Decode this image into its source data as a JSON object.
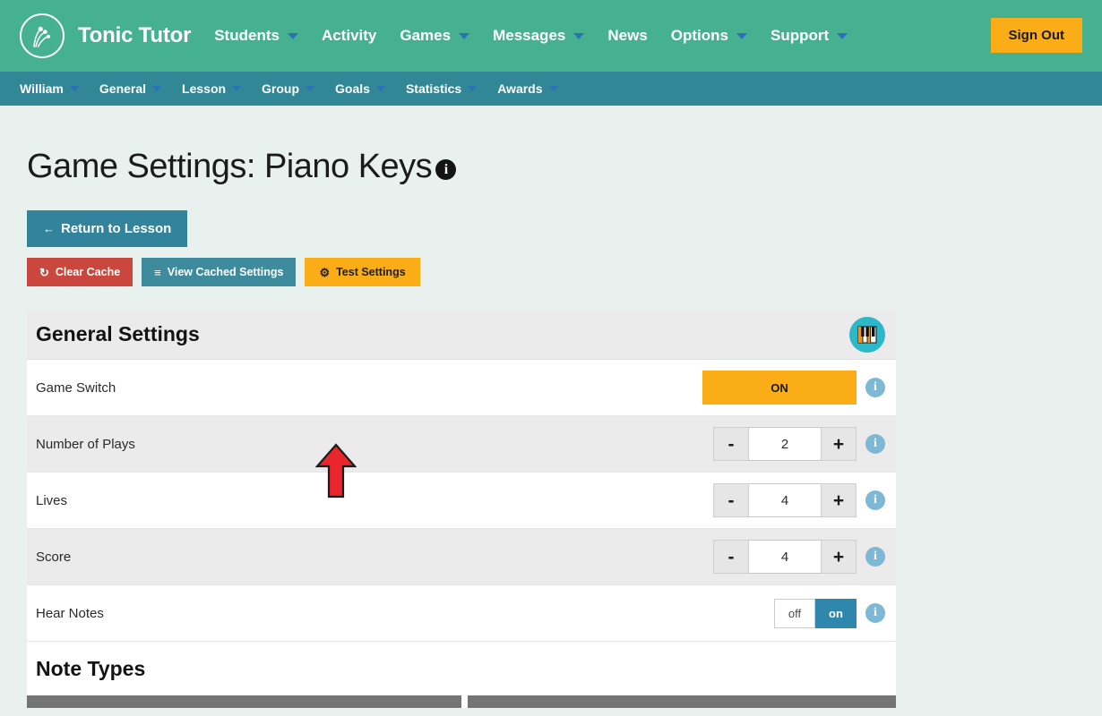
{
  "topnav": {
    "brand": "Tonic Tutor",
    "logo_icon": "tonic-sprout-logo",
    "items": [
      {
        "label": "Students",
        "has_caret": true
      },
      {
        "label": "Activity",
        "has_caret": false
      },
      {
        "label": "Games",
        "has_caret": true
      },
      {
        "label": "Messages",
        "has_caret": true
      },
      {
        "label": "News",
        "has_caret": false
      },
      {
        "label": "Options",
        "has_caret": true
      },
      {
        "label": "Support",
        "has_caret": true
      }
    ],
    "signout_label": "Sign Out",
    "bg_color": "#45b191",
    "signout_color": "#fbad17"
  },
  "subnav": {
    "bg_color": "#318795",
    "items": [
      {
        "label": "William",
        "has_caret": true
      },
      {
        "label": "General",
        "has_caret": true
      },
      {
        "label": "Lesson",
        "has_caret": true
      },
      {
        "label": "Group",
        "has_caret": true
      },
      {
        "label": "Goals",
        "has_caret": true
      },
      {
        "label": "Statistics",
        "has_caret": true
      },
      {
        "label": "Awards",
        "has_caret": true
      }
    ]
  },
  "page": {
    "title": "Game Settings: Piano Keys",
    "title_info_icon": "info-icon",
    "return_button": {
      "label": "Return to Lesson",
      "icon": "arrow-left-icon",
      "glyph": "←",
      "color": "#31849b"
    },
    "action_buttons": [
      {
        "label": "Clear Cache",
        "icon": "refresh-icon",
        "glyph": "↻",
        "color": "#c9473c",
        "name": "clear-cache-button"
      },
      {
        "label": "View Cached Settings",
        "icon": "hamburger-icon",
        "glyph": "≡",
        "color": "#3d8b9c",
        "name": "view-cached-settings-button"
      },
      {
        "label": "Test Settings",
        "icon": "gear-icon",
        "glyph": "⚙",
        "color": "#fbad17",
        "name": "test-settings-button"
      }
    ],
    "annotation": {
      "type": "red-arrow-up",
      "points_to": "Test Settings",
      "color": "#e8262b"
    }
  },
  "panel": {
    "header_title": "General Settings",
    "game_badge_icon": "piano-keys-icon",
    "rows": [
      {
        "label": "Game Switch",
        "control": "onoff",
        "value": "ON",
        "info_icon": "info-icon",
        "name": "setting-game-switch"
      },
      {
        "label": "Number of Plays",
        "control": "stepper",
        "value": "2",
        "minus": "-",
        "plus": "+",
        "info_icon": "info-icon",
        "name": "setting-number-of-plays"
      },
      {
        "label": "Lives",
        "control": "stepper",
        "value": "4",
        "minus": "-",
        "plus": "+",
        "info_icon": "info-icon",
        "name": "setting-lives"
      },
      {
        "label": "Score",
        "control": "stepper",
        "value": "4",
        "minus": "-",
        "plus": "+",
        "info_icon": "info-icon",
        "name": "setting-score"
      },
      {
        "label": "Hear Notes",
        "control": "toggle",
        "off_label": "off",
        "on_label": "on",
        "selected": "on",
        "info_icon": "info-icon",
        "name": "setting-hear-notes"
      }
    ],
    "subsection_title": "Note Types"
  }
}
